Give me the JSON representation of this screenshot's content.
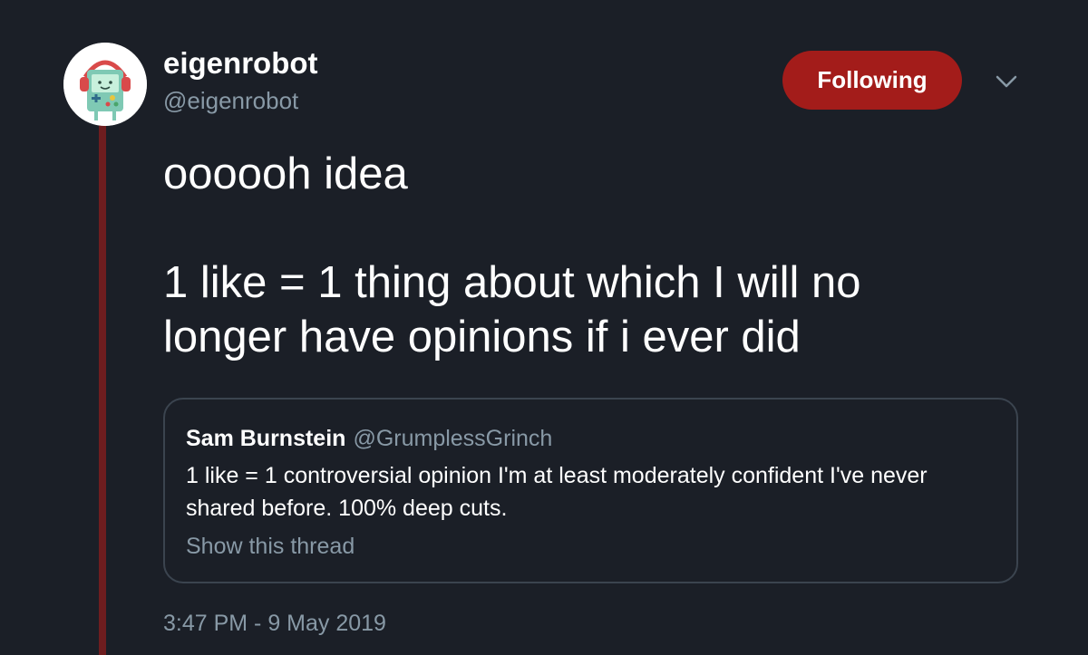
{
  "author": {
    "display_name": "eigenrobot",
    "handle": "@eigenrobot",
    "avatar_icon": "bmo-robot-with-headphones-icon"
  },
  "follow_button": {
    "label": "Following",
    "color": "#a31c1a"
  },
  "menu": {
    "icon": "chevron-down-icon"
  },
  "tweet": {
    "line1": "oooooh idea",
    "line2": "1 like = 1 thing about which I will no longer have opinions if i ever did"
  },
  "quoted_tweet": {
    "display_name": "Sam Burnstein",
    "handle": "@GrumplessGrinch",
    "text": "1 like = 1 controversial opinion I'm at least moderately confident I've never shared before. 100% deep cuts.",
    "show_thread": "Show this thread"
  },
  "timestamp": "3:47 PM - 9 May 2019",
  "colors": {
    "background": "#1b1f27",
    "thread_line": "#6e1d1f",
    "secondary_text": "#8899a6"
  }
}
